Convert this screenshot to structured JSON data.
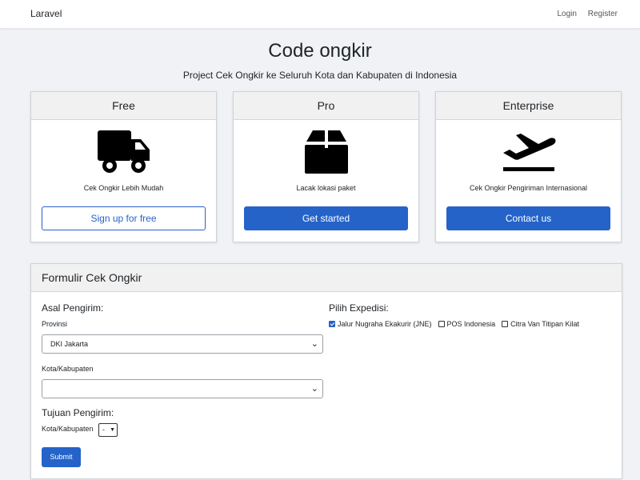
{
  "navbar": {
    "brand": "Laravel",
    "links": [
      "Login",
      "Register"
    ]
  },
  "header": {
    "title": "Code ongkir",
    "subtitle": "Project Cek Ongkir ke Seluruh Kota dan Kabupaten di Indonesia"
  },
  "plans": [
    {
      "name": "Free",
      "icon": "truck-icon",
      "desc": "Cek Ongkir Lebih Mudah",
      "button": "Sign up for free"
    },
    {
      "name": "Pro",
      "icon": "box-icon",
      "desc": "Lacak lokasi paket",
      "button": "Get started"
    },
    {
      "name": "Enterprise",
      "icon": "plane-departure-icon",
      "desc": "Cek Ongkir Pengiriman Internasional",
      "button": "Contact us"
    }
  ],
  "form": {
    "title": "Formulir Cek Ongkir",
    "origin_heading": "Asal Pengirim:",
    "province_label": "Provinsi",
    "province_value": "DKI Jakarta",
    "city_label": "Kota/Kabupaten",
    "city_value": "",
    "dest_heading": "Tujuan Pengirim:",
    "dest_city_label": "Kota/Kabupaten",
    "dest_city_value": "-",
    "submit": "Submit",
    "courier_heading": "Pilih Expedisi:",
    "couriers": [
      {
        "label": "Jalur Nugraha Ekakurir (JNE)",
        "checked": true
      },
      {
        "label": "POS Indonesia",
        "checked": false
      },
      {
        "label": "Citra Van Titipan Kilat",
        "checked": false
      }
    ]
  },
  "colors": {
    "primary": "#2563c9",
    "background": "#f0f2f5"
  }
}
